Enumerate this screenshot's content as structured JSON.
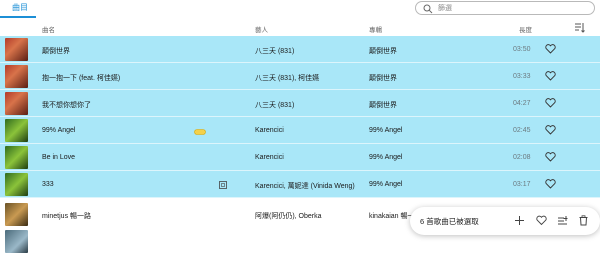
{
  "tabs": [
    {
      "label": "曲目",
      "active": true
    }
  ],
  "search": {
    "placeholder": "篩選"
  },
  "columns": {
    "title": "曲名",
    "artist": "藝人",
    "album": "專輯",
    "duration": "長度"
  },
  "rows": [
    {
      "title": "顛倒世界",
      "artist": "八三夭 (831)",
      "album": "顛倒世界",
      "duration": "03:50",
      "selected": true
    },
    {
      "title": "抱一抱一下 (feat. 柯佳嬿)",
      "artist": "八三夭 (831), 柯佳嬿",
      "album": "顛倒世界",
      "duration": "03:33",
      "selected": true
    },
    {
      "title": "我不想你想你了",
      "artist": "八三夭 (831)",
      "album": "顛倒世界",
      "duration": "04:27",
      "selected": true
    },
    {
      "title": "99% Angel",
      "artist": "Karencici",
      "album": "99% Angel",
      "duration": "02:45",
      "selected": true,
      "badge": "hires"
    },
    {
      "title": "Be in Love",
      "artist": "Karencici",
      "album": "99% Angel",
      "duration": "02:08",
      "selected": true
    },
    {
      "title": "333",
      "artist": "Karencici, 萬妮達 (Vinida Weng)",
      "album": "99% Angel",
      "duration": "03:17",
      "selected": true,
      "badge": "explicit"
    },
    {
      "title": "minetjus 暢一路",
      "artist": "阿爆(阿仍仍), Oberka",
      "album": "kinakaian 暢一路",
      "duration": "",
      "selected": false
    },
    {
      "title": "",
      "artist": "",
      "album": "",
      "duration": "",
      "selected": false
    }
  ],
  "selection_bar": {
    "text": "6 首歌曲已被選取"
  },
  "colors": {
    "accent": "#1c8fd6",
    "selected_row": "#a9e7f8"
  }
}
